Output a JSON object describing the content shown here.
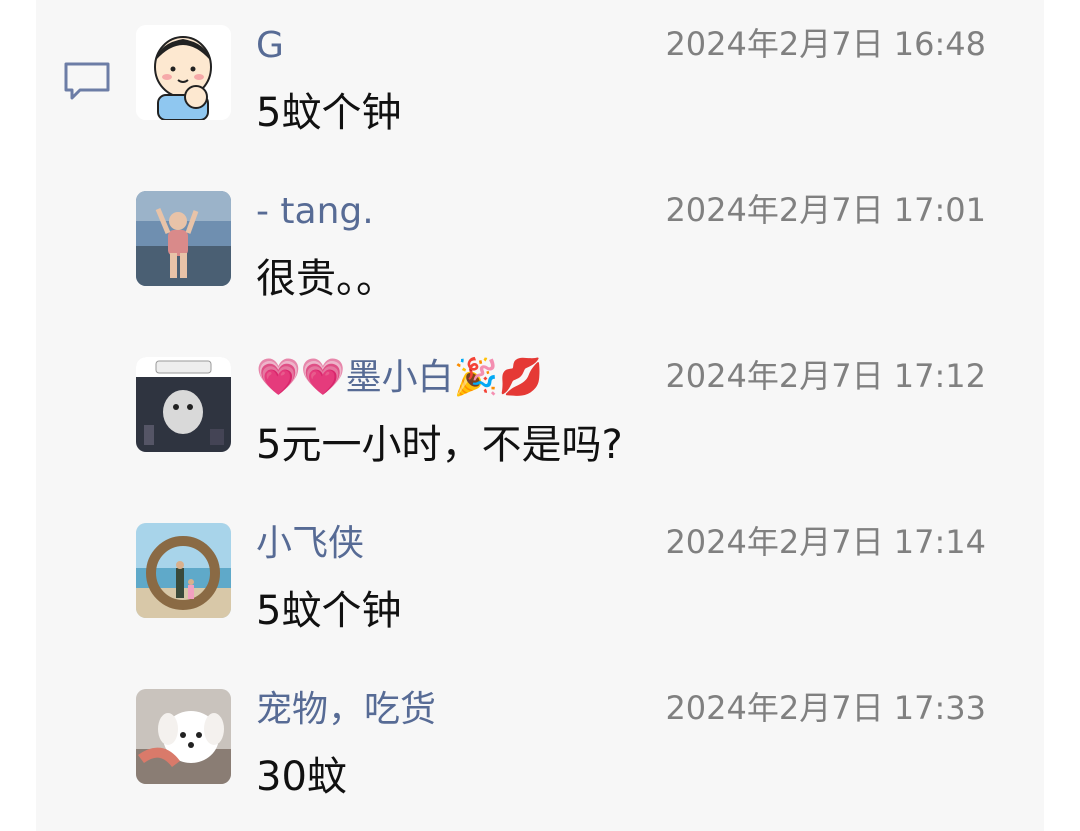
{
  "comments": [
    {
      "name": "G",
      "time": "2024年2月7日 16:48",
      "message": "5蚊个钟",
      "avatar_icon": "cartoon-parent-baby-avatar"
    },
    {
      "name": "- tang.",
      "time": "2024年2月7日 17:01",
      "message": "很贵。。",
      "avatar_icon": "sports-photo-avatar"
    },
    {
      "name": "💗💗墨小白🎉💋",
      "time": "2024年2月7日 17:12",
      "message": "5元一小时，不是吗?",
      "avatar_icon": "meme-avatar"
    },
    {
      "name": "小飞侠",
      "time": "2024年2月7日 17:14",
      "message": "5蚊个钟",
      "avatar_icon": "beach-photo-avatar"
    },
    {
      "name": "宠物，吃货",
      "time": "2024年2月7日 17:33",
      "message": "30蚊",
      "avatar_icon": "white-puppy-avatar"
    }
  ],
  "colors": {
    "name": "#576b95",
    "time": "#808080",
    "message": "#111111",
    "panel_bg": "#f7f7f7"
  }
}
